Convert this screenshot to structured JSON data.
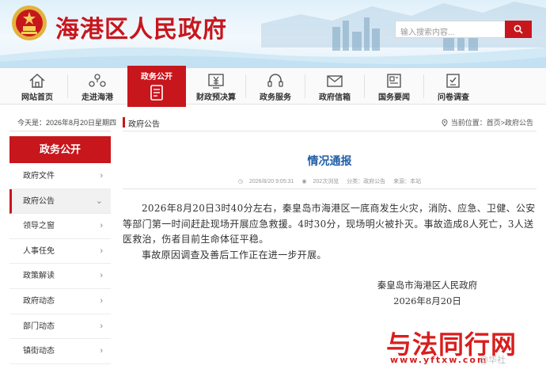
{
  "header": {
    "site_title": "海港区人民政府",
    "search_placeholder": "输入搜索内容..."
  },
  "nav": {
    "items": [
      {
        "label": "网站首页",
        "icon": "home-icon"
      },
      {
        "label": "走进海港",
        "icon": "people-icon"
      },
      {
        "label": "政务公开",
        "icon": "document-icon",
        "active": true
      },
      {
        "label": "财政预决算",
        "icon": "yuan-chart-icon"
      },
      {
        "label": "政务服务",
        "icon": "headset-icon"
      },
      {
        "label": "政府信箱",
        "icon": "mail-icon"
      },
      {
        "label": "国务要闻",
        "icon": "news-icon"
      },
      {
        "label": "问卷调查",
        "icon": "survey-icon"
      }
    ]
  },
  "sidebar": {
    "date": "今天是：2026年8月20日星期四",
    "heading": "政务公开",
    "items": [
      {
        "label": "政府文件"
      },
      {
        "label": "政府公告",
        "active": true
      },
      {
        "label": "领导之窗"
      },
      {
        "label": "人事任免"
      },
      {
        "label": "政策解读"
      },
      {
        "label": "政府动态"
      },
      {
        "label": "部门动态"
      },
      {
        "label": "镇街动态"
      }
    ]
  },
  "breadcrumb": {
    "category": "政府公告",
    "location": "当前位置：首页>政府公告"
  },
  "article": {
    "title": "情况通报",
    "meta": {
      "date": "2026/8/20 9:05:31",
      "views": "202次浏览",
      "category": "分类：政府公告",
      "source": "来源：本站"
    },
    "paragraphs": [
      "2026年8月20日3时40分左右，秦皇岛市海港区一底商发生火灾，消防、应急、卫健、公安等部门第一时间赶赴现场开展应急救援。4时30分，现场明火被扑灭。事故造成8人死亡，3人送医救治，伤者目前生命体征平稳。",
      "事故原因调查及善后工作正在进一步开展。"
    ],
    "signature": "秦皇岛市海港区人民政府",
    "sign_date": "2026年8月20日"
  },
  "watermark": {
    "main": "与法同行网",
    "url": "www.yftxw.com",
    "weibo": "@华社"
  },
  "colors": {
    "brand_red": "#c8161d",
    "title_blue": "#1f5ea8"
  }
}
